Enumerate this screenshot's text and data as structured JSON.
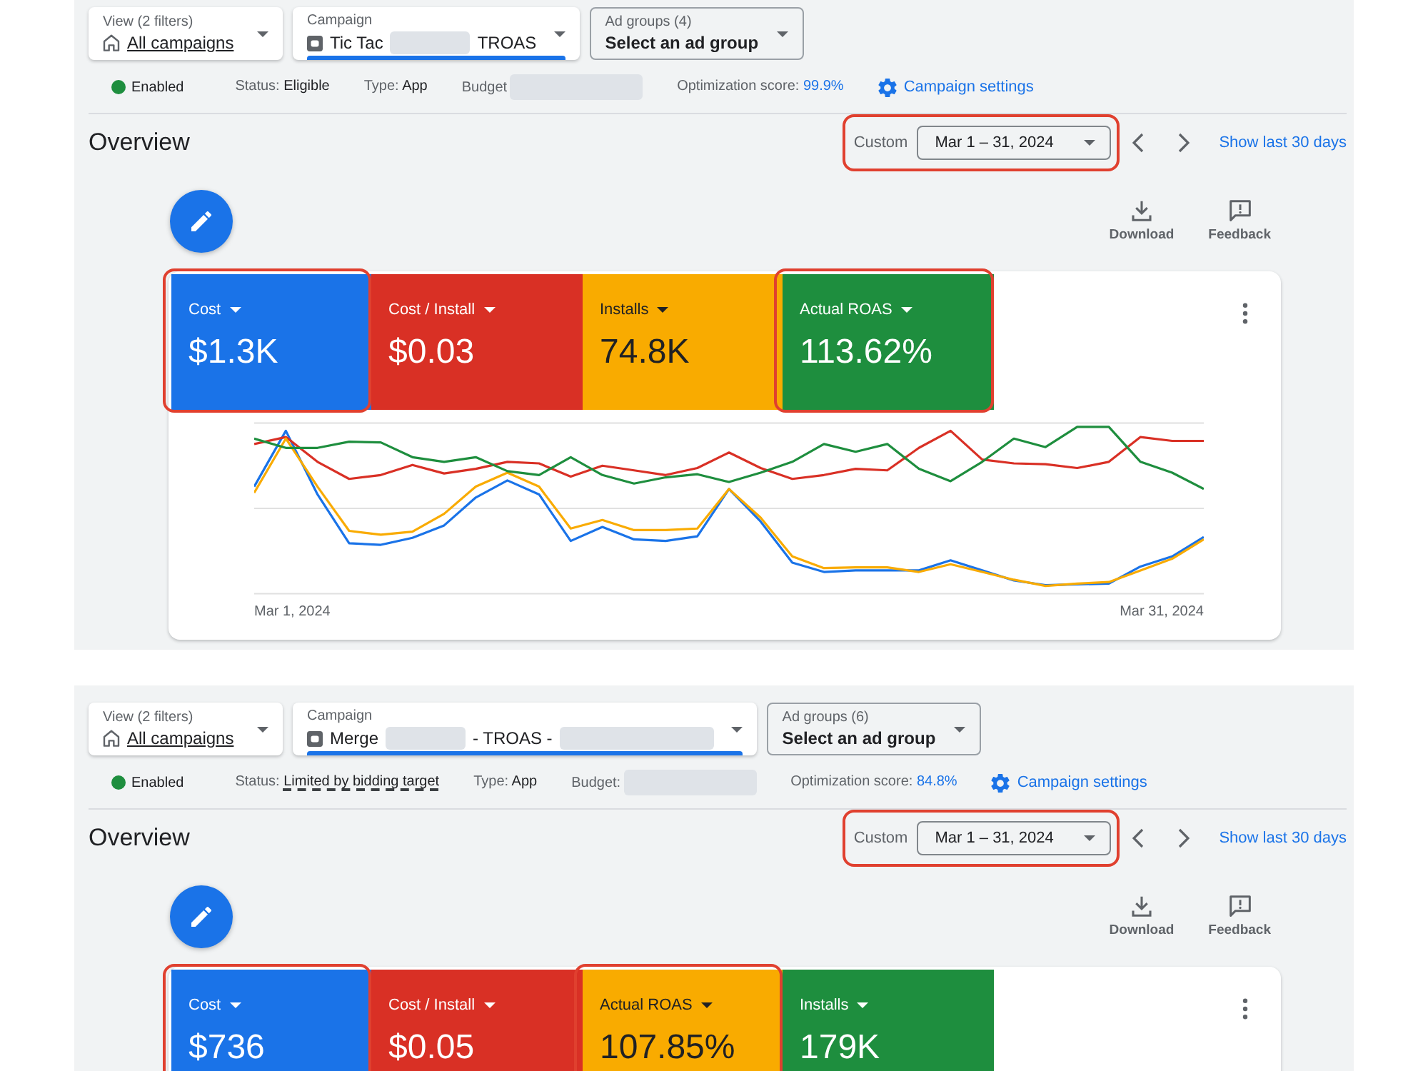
{
  "panels": [
    {
      "selectors": [
        {
          "kind": "view",
          "label": "View (2 filters)",
          "value": "All campaigns",
          "selected": false
        },
        {
          "kind": "campaign",
          "label": "Campaign",
          "name_parts": [
            {
              "kind": "text",
              "text": "Tic Tac"
            },
            {
              "kind": "redacted"
            },
            {
              "kind": "text",
              "text": "TROAS"
            }
          ],
          "selected": true
        },
        {
          "kind": "ad_group",
          "label": "Ad groups (4)",
          "value": "Select an ad group",
          "selected": false
        }
      ],
      "status_row": {
        "state": "Enabled",
        "status_label": "Status:",
        "status_value": "Eligible",
        "status_underlined": false,
        "type_label": "Type:",
        "type_value": "App",
        "budget_label": "Budget",
        "budget_redacted": true,
        "score_label": "Optimization score:",
        "score_value": "99.9%",
        "settings_link": "Campaign settings"
      },
      "overview": {
        "title": "Overview",
        "date_range": {
          "label": "Custom",
          "value": "Mar 1 – 31, 2024",
          "highlighted": true
        },
        "show_last_link": "Show last 30 days"
      },
      "actions": [
        {
          "kind": "download",
          "label": "Download"
        },
        {
          "kind": "feedback",
          "label": "Feedback"
        }
      ],
      "metrics": [
        {
          "label": "Cost",
          "value": "$1.3K",
          "color": "#1a73e8",
          "highlighted": true
        },
        {
          "label": "Cost / Install",
          "value": "$0.03",
          "color": "#d93025",
          "highlighted": false
        },
        {
          "label": "Installs",
          "value": "74.8K",
          "color": "#f9ab00",
          "highlighted": false
        },
        {
          "label": "Actual ROAS",
          "value": "113.62%",
          "color": "#1e8e3e",
          "highlighted": true
        }
      ],
      "chart": {
        "start_label": "Mar 1, 2024",
        "end_label": "Mar 31, 2024"
      }
    },
    {
      "selectors": [
        {
          "kind": "view",
          "label": "View (2 filters)",
          "value": "All campaigns",
          "selected": false
        },
        {
          "kind": "campaign",
          "label": "Campaign",
          "name_parts": [
            {
              "kind": "text",
              "text": "Merge"
            },
            {
              "kind": "redacted"
            },
            {
              "kind": "text",
              "text": "- TROAS -"
            },
            {
              "kind": "redacted"
            }
          ],
          "selected": true
        },
        {
          "kind": "ad_group",
          "label": "Ad groups (6)",
          "value": "Select an ad group",
          "selected": false
        }
      ],
      "status_row": {
        "state": "Enabled",
        "status_label": "Status:",
        "status_value": "Limited by bidding target",
        "status_underlined": true,
        "type_label": "Type:",
        "type_value": "App",
        "budget_label": "Budget:",
        "budget_redacted": true,
        "score_label": "Optimization score:",
        "score_value": "84.8%",
        "settings_link": "Campaign settings"
      },
      "overview": {
        "title": "Overview",
        "date_range": {
          "label": "Custom",
          "value": "Mar 1 – 31, 2024",
          "highlighted": true
        },
        "show_last_link": "Show last 30 days"
      },
      "actions": [
        {
          "kind": "download",
          "label": "Download"
        },
        {
          "kind": "feedback",
          "label": "Feedback"
        }
      ],
      "metrics": [
        {
          "label": "Cost",
          "value": "$736",
          "color": "#1a73e8",
          "highlighted": true
        },
        {
          "label": "Cost / Install",
          "value": "$0.05",
          "color": "#d93025",
          "highlighted": false
        },
        {
          "label": "Actual ROAS",
          "value": "107.85%",
          "color": "#f9ab00",
          "highlighted": true
        },
        {
          "label": "Installs",
          "value": "179K",
          "color": "#1e8e3e",
          "highlighted": false
        }
      ]
    }
  ]
}
